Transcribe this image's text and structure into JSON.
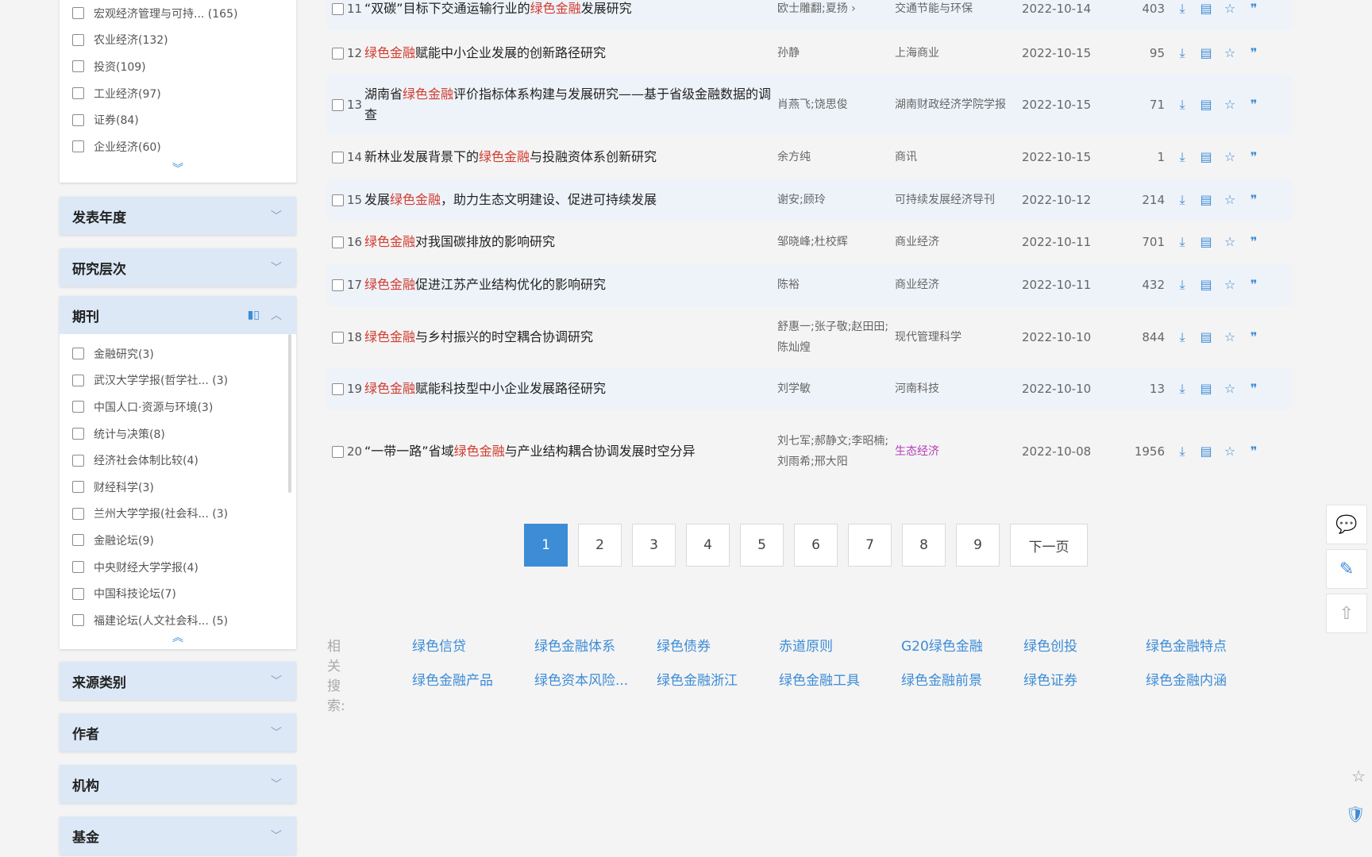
{
  "sidebar": {
    "top_items": [
      "宏观经济管理与可持... (165)",
      "农业经济(132)",
      "投资(109)",
      "工业经济(97)",
      "证券(84)",
      "企业经济(60)"
    ],
    "sections": [
      "发表年度",
      "研究层次",
      "期刊",
      "来源类别",
      "作者",
      "机构",
      "基金"
    ],
    "journals": [
      "金融研究(3)",
      "武汉大学学报(哲学社... (3)",
      "中国人口·资源与环境(3)",
      "统计与决策(8)",
      "经济社会体制比较(4)",
      "财经科学(3)",
      "兰州大学学报(社会科... (3)",
      "金融论坛(9)",
      "中央财经大学学报(4)",
      "中国科技论坛(7)",
      "福建论坛(人文社会科... (5)"
    ]
  },
  "results": {
    "rows": [
      {
        "idx": "11",
        "title_pre": "“双碳”目标下交通运输行业的",
        "title_hl": "绿色金融",
        "title_post": "发展研究",
        "authors": "欧士雕翻;夏扬 ›",
        "source": "交通节能与环保",
        "date": "2022-10-14",
        "downloads": "403"
      },
      {
        "idx": "12",
        "title_pre": "",
        "title_hl": "绿色金融",
        "title_post": "赋能中小企业发展的创新路径研究",
        "authors": "孙静",
        "source": "上海商业",
        "date": "2022-10-15",
        "downloads": "95"
      },
      {
        "idx": "13",
        "title_pre": "湖南省",
        "title_hl": "绿色金融",
        "title_post": "评价指标体系构建与发展研究——基于省级金融数据的调查",
        "authors": "肖燕飞;饶思俊",
        "source": "湖南财政经济学院学报",
        "date": "2022-10-15",
        "downloads": "71"
      },
      {
        "idx": "14",
        "title_pre": "新林业发展背景下的",
        "title_hl": "绿色金融",
        "title_post": "与投融资体系创新研究",
        "authors": "余方纯",
        "source": "商讯",
        "date": "2022-10-15",
        "downloads": "1"
      },
      {
        "idx": "15",
        "title_pre": "发展",
        "title_hl": "绿色金融",
        "title_post": "，助力生态文明建设、促进可持续发展",
        "authors": "谢安;顾玲",
        "source": "可持续发展经济导刊",
        "date": "2022-10-12",
        "downloads": "214"
      },
      {
        "idx": "16",
        "title_pre": "",
        "title_hl": "绿色金融",
        "title_post": "对我国碳排放的影响研究",
        "authors": "邹晓峰;杜校辉",
        "source": "商业经济",
        "date": "2022-10-11",
        "downloads": "701"
      },
      {
        "idx": "17",
        "title_pre": "",
        "title_hl": "绿色金融",
        "title_post": "促进江苏产业结构优化的影响研究",
        "authors": "陈裕",
        "source": "商业经济",
        "date": "2022-10-11",
        "downloads": "432"
      },
      {
        "idx": "18",
        "title_pre": "",
        "title_hl": "绿色金融",
        "title_post": "与乡村振兴的时空耦合协调研究",
        "authors": "舒惠一;张子敬;赵田田;陈灿煌",
        "source": "现代管理科学",
        "date": "2022-10-10",
        "downloads": "844"
      },
      {
        "idx": "19",
        "title_pre": "",
        "title_hl": "绿色金融",
        "title_post": "赋能科技型中小企业发展路径研究",
        "authors": "刘学敏",
        "source": "河南科技",
        "date": "2022-10-10",
        "downloads": "13"
      },
      {
        "idx": "20",
        "title_pre": "“一带一路”省域",
        "title_hl": "绿色金融",
        "title_post": "与产业结构耦合协调发展时空分异",
        "authors": "刘七军;郝静文;李昭楠;刘雨希;邢大阳",
        "source": "生态经济",
        "date": "2022-10-08",
        "downloads": "1956"
      }
    ]
  },
  "pagination": {
    "pages": [
      "1",
      "2",
      "3",
      "4",
      "5",
      "6",
      "7",
      "8",
      "9"
    ],
    "active": "1",
    "next_label": "下一页"
  },
  "related": {
    "label": "相关搜索:",
    "terms": [
      "绿色信贷",
      "绿色金融体系",
      "绿色债券",
      "赤道原则",
      "G20绿色金融",
      "绿色创投",
      "绿色金融特点",
      "绿色金融产品",
      "绿色资本风险...",
      "绿色金融浙江",
      "绿色金融工具",
      "绿色金融前景",
      "绿色证券",
      "绿色金融内涵"
    ]
  },
  "icons": {
    "download": "download-icon",
    "read": "read-icon",
    "favorite": "star-icon",
    "quote": "quote-icon"
  },
  "colors": {
    "accent": "#3d8cd6",
    "highlight": "#d23b2e",
    "source_purple": "#b43fb9",
    "section_bg": "#dce8f6"
  }
}
